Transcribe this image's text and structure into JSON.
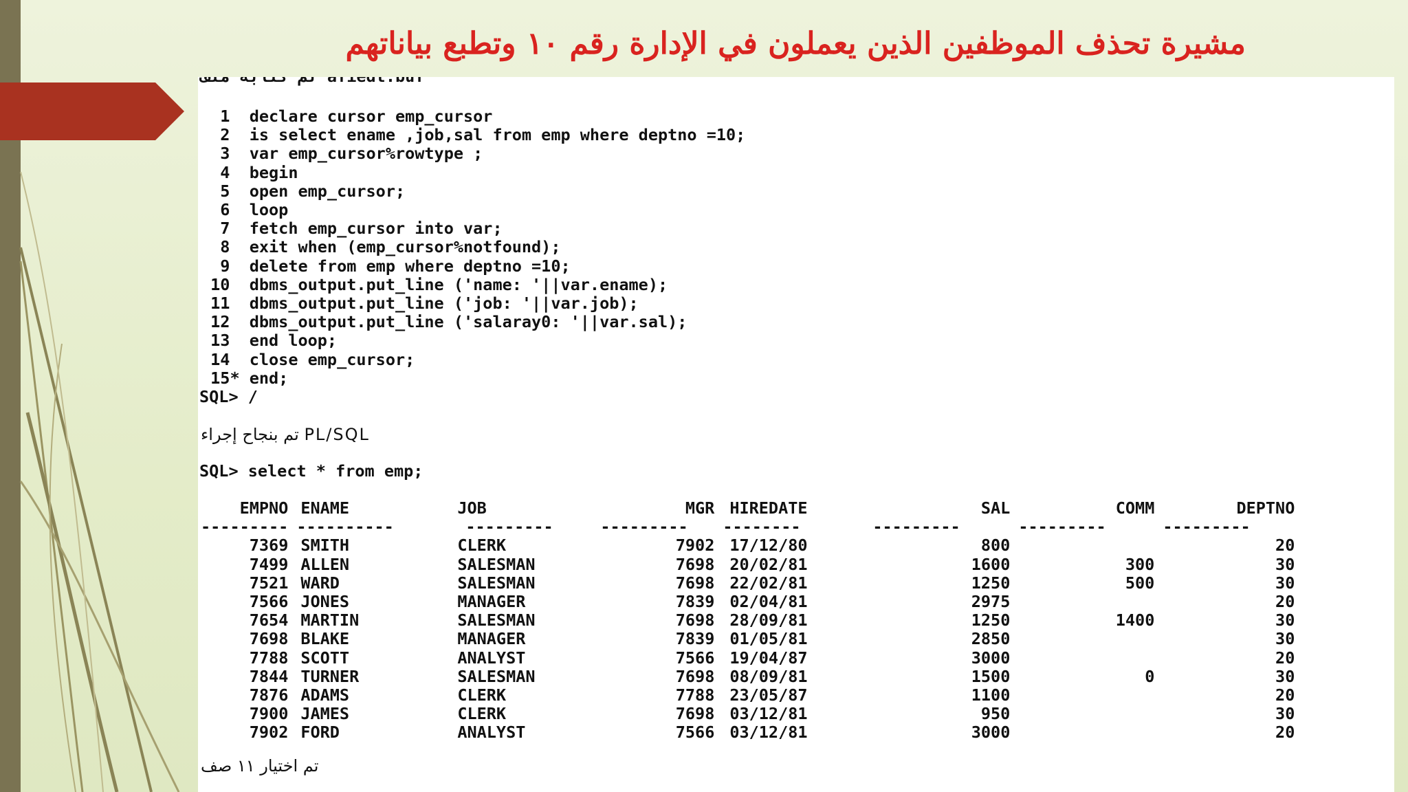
{
  "slide": {
    "title": "مشيرة تحذف الموظفين الذين يعملون في الإدارة رقم ١٠ وتطبع بياناتهم",
    "title_color": "#d9231f",
    "accent_bar_color": "#7a7352",
    "arrow_color": "#a93220"
  },
  "terminal": {
    "cut_line": "تم كتابة ملف afiedt.buf",
    "code_lines": [
      "  1  declare cursor emp_cursor",
      "  2  is select ename ,job,sal from emp where deptno =10;",
      "  3  var emp_cursor%rowtype ;",
      "  4  begin",
      "  5  open emp_cursor;",
      "  6  loop",
      "  7  fetch emp_cursor into var;",
      "  8  exit when (emp_cursor%notfound);",
      "  9  delete from emp where deptno =10;",
      " 10  dbms_output.put_line ('name: '||var.ename);",
      " 11  dbms_output.put_line ('job: '||var.job);",
      " 12  dbms_output.put_line ('salaray0: '||var.sal);",
      " 13  end loop;",
      " 14  close emp_cursor;",
      " 15* end;"
    ],
    "prompt1": "SQL> /",
    "success_msg": "تم بنجاح إجراء PL/SQL",
    "prompt2": "SQL> select * from emp;",
    "columns": [
      "EMPNO",
      "ENAME",
      "JOB",
      "MGR",
      "HIREDATE",
      "SAL",
      "COMM",
      "DEPTNO"
    ],
    "separator": [
      "---------",
      "----------",
      "---------",
      "---------",
      "--------",
      "---------",
      "---------",
      "---------"
    ],
    "rows": [
      [
        "7369",
        "SMITH",
        "CLERK",
        "7902",
        "17/12/80",
        "800",
        "",
        "20"
      ],
      [
        "7499",
        "ALLEN",
        "SALESMAN",
        "7698",
        "20/02/81",
        "1600",
        "300",
        "30"
      ],
      [
        "7521",
        "WARD",
        "SALESMAN",
        "7698",
        "22/02/81",
        "1250",
        "500",
        "30"
      ],
      [
        "7566",
        "JONES",
        "MANAGER",
        "7839",
        "02/04/81",
        "2975",
        "",
        "20"
      ],
      [
        "7654",
        "MARTIN",
        "SALESMAN",
        "7698",
        "28/09/81",
        "1250",
        "1400",
        "30"
      ],
      [
        "7698",
        "BLAKE",
        "MANAGER",
        "7839",
        "01/05/81",
        "2850",
        "",
        "30"
      ],
      [
        "7788",
        "SCOTT",
        "ANALYST",
        "7566",
        "19/04/87",
        "3000",
        "",
        "20"
      ],
      [
        "7844",
        "TURNER",
        "SALESMAN",
        "7698",
        "08/09/81",
        "1500",
        "0",
        "30"
      ],
      [
        "7876",
        "ADAMS",
        "CLERK",
        "7788",
        "23/05/87",
        "1100",
        "",
        "20"
      ],
      [
        "7900",
        "JAMES",
        "CLERK",
        "7698",
        "03/12/81",
        "950",
        "",
        "30"
      ],
      [
        "7902",
        "FORD",
        "ANALYST",
        "7566",
        "03/12/81",
        "3000",
        "",
        "20"
      ]
    ],
    "rows_selected_msg": "تم اختيار ١١ صف"
  }
}
